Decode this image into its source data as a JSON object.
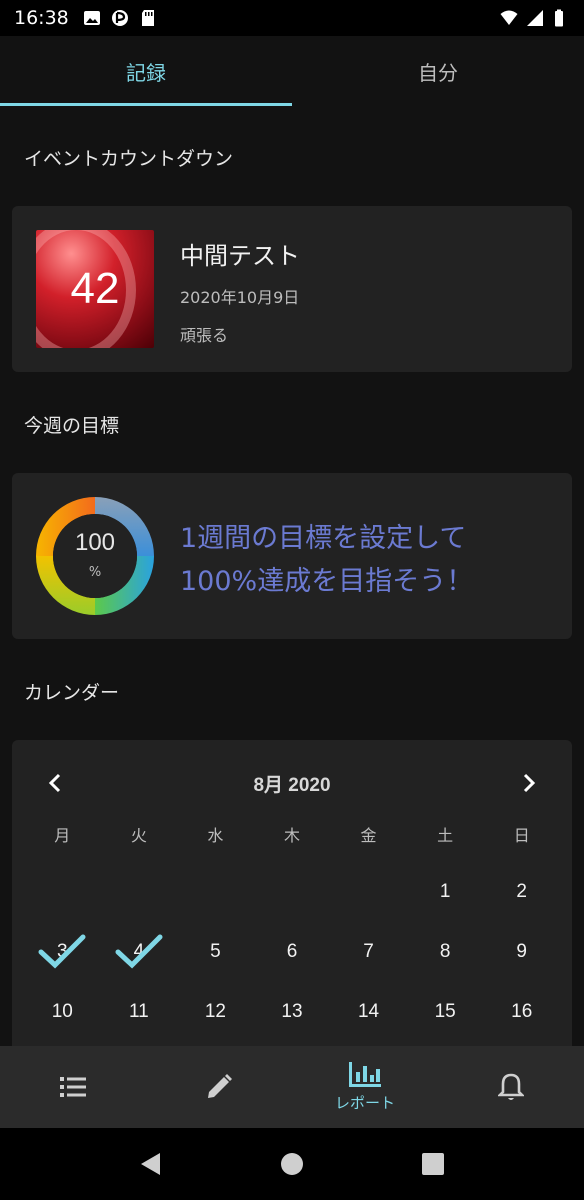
{
  "status_bar": {
    "time": "16:38"
  },
  "tabs": [
    {
      "label": "記録",
      "active": true
    },
    {
      "label": "自分",
      "active": false
    }
  ],
  "countdown": {
    "section_title": "イベントカウントダウン",
    "days": "42",
    "name": "中間テスト",
    "date": "2020年10月9日",
    "note": "頑張る"
  },
  "goal": {
    "section_title": "今週の目標",
    "value": "100",
    "unit": "%",
    "progress_percent": 100,
    "message_line1": "1週間の目標を設定して",
    "message_line2": "100%達成を目指そう！"
  },
  "calendar": {
    "section_title": "カレンダー",
    "month_label": "8月 2020",
    "weekdays": [
      "月",
      "火",
      "水",
      "木",
      "金",
      "土",
      "日"
    ],
    "weeks": [
      [
        "",
        "",
        "",
        "",
        "",
        "1",
        "2"
      ],
      [
        "3",
        "4",
        "5",
        "6",
        "7",
        "8",
        "9"
      ],
      [
        "10",
        "11",
        "12",
        "13",
        "14",
        "15",
        "16"
      ]
    ],
    "checked_days": [
      "3",
      "4"
    ]
  },
  "bottom_nav": {
    "items": [
      {
        "id": "list",
        "icon": "list-icon",
        "label": ""
      },
      {
        "id": "edit",
        "icon": "pencil-icon",
        "label": ""
      },
      {
        "id": "report",
        "icon": "bar-chart-icon",
        "label": "レポート",
        "active": true
      },
      {
        "id": "notify",
        "icon": "bell-icon",
        "label": ""
      }
    ]
  },
  "colors": {
    "accent": "#7fd7e6",
    "goal_text": "#6b7ad1",
    "card_bg": "#222222",
    "background": "#121212"
  }
}
